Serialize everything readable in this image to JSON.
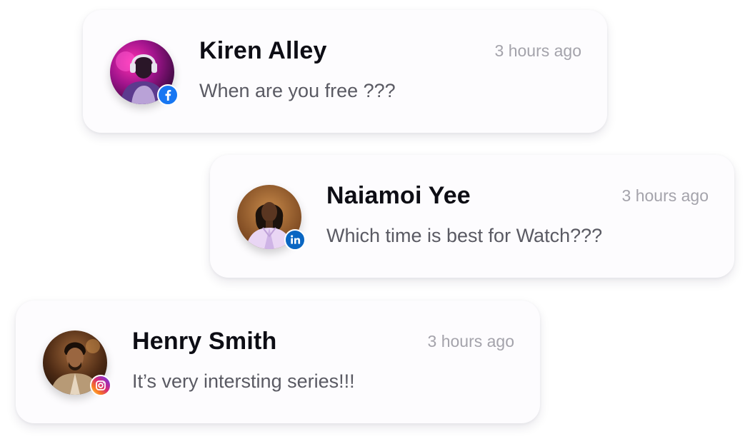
{
  "messages": [
    {
      "name": "Kiren Alley",
      "time": "3 hours ago",
      "text": "When are you free ???",
      "platform_icon": "facebook-icon",
      "platform_color": "#1877f2"
    },
    {
      "name": "Naiamoi Yee",
      "time": "3 hours ago",
      "text": "Which time is best for Watch???",
      "platform_icon": "linkedin-icon",
      "platform_color": "#0a66c2"
    },
    {
      "name": "Henry Smith",
      "time": "3 hours ago",
      "text": "It’s very intersting series!!!",
      "platform_icon": "instagram-icon",
      "platform_color": "#d62976"
    }
  ]
}
